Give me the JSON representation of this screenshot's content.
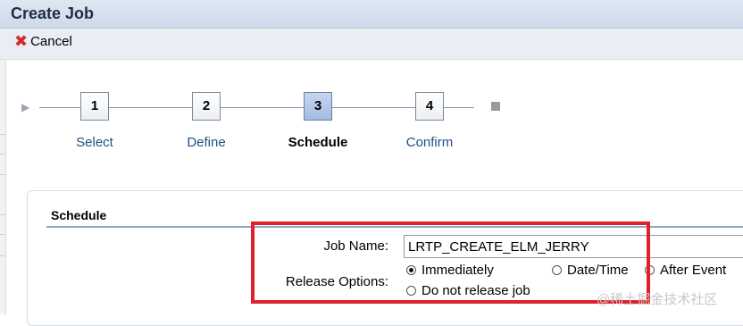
{
  "window": {
    "title": "Create Job"
  },
  "toolbar": {
    "cancel_label": "Cancel"
  },
  "steps": [
    {
      "number": "1",
      "label": "Select",
      "active": false
    },
    {
      "number": "2",
      "label": "Define",
      "active": false
    },
    {
      "number": "3",
      "label": "Schedule",
      "active": true
    },
    {
      "number": "4",
      "label": "Confirm",
      "active": false
    }
  ],
  "section": {
    "title": "Schedule"
  },
  "form": {
    "job_name_label": "Job Name:",
    "job_name_value": "LRTP_CREATE_ELM_JERRY",
    "release_label": "Release Options:",
    "options": [
      {
        "label": "Immediately",
        "selected": true
      },
      {
        "label": "Date/Time",
        "selected": false
      },
      {
        "label": "After Event",
        "selected": false
      },
      {
        "label": "Do not release job",
        "selected": false
      }
    ]
  },
  "watermark": "@稀土掘金技术社区",
  "colors": {
    "highlight": "#e0202b",
    "accent": "#1f4f8a"
  }
}
